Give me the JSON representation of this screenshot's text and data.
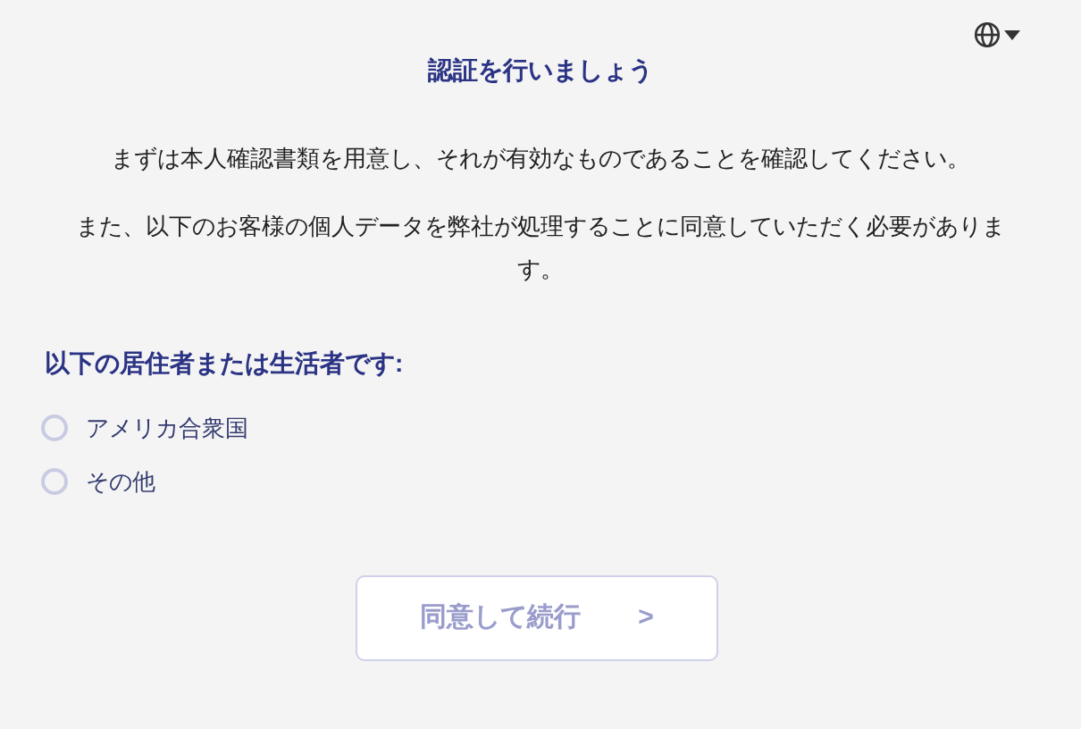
{
  "language_menu": {
    "expanded": false
  },
  "title": "認証を行いましょう",
  "paragraphs": [
    "まずは本人確認書類を用意し、それが有効なものであることを確認してください。",
    "また、以下のお客様の個人データを弊社が処理することに同意していただく必要があります。"
  ],
  "question": "以下の居住者または生活者です:",
  "options": [
    {
      "label": "アメリカ合衆国",
      "selected": false
    },
    {
      "label": "その他",
      "selected": false
    }
  ],
  "continue_button": {
    "label": "同意して続行",
    "arrow": ">",
    "disabled": true
  }
}
